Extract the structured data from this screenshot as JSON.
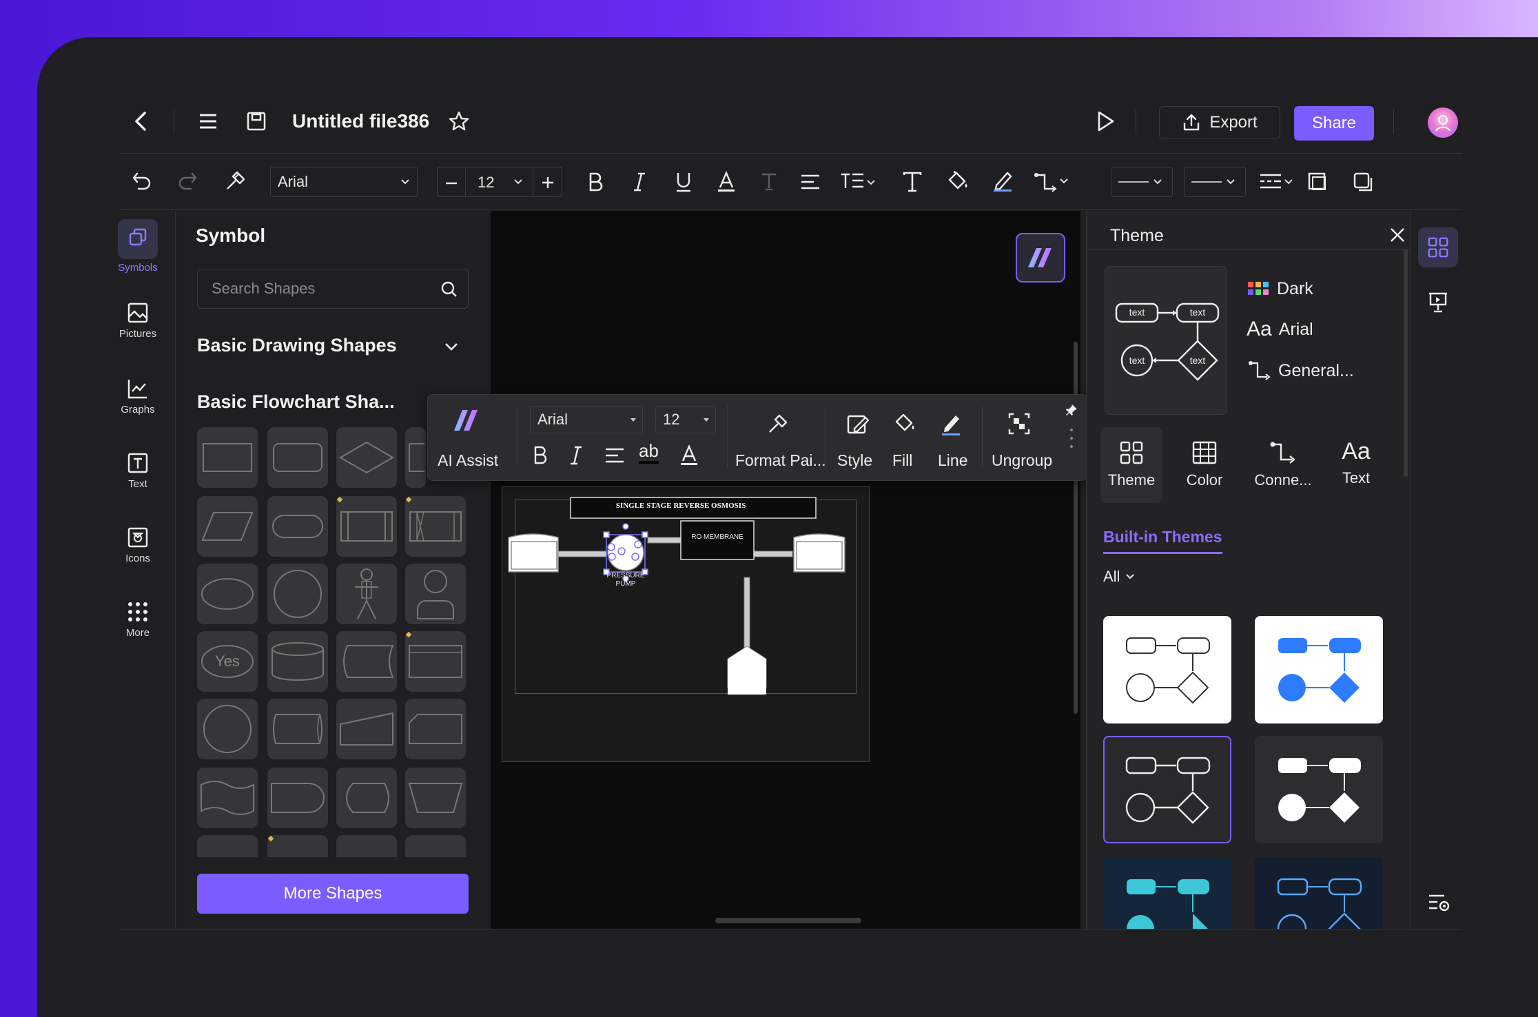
{
  "header": {
    "file_title": "Untitled file386",
    "export_label": "Export",
    "share_label": "Share"
  },
  "toolbar": {
    "font": "Arial",
    "font_size": "12"
  },
  "leftnav": {
    "items": [
      {
        "label": "Symbols",
        "icon": "symbols-icon"
      },
      {
        "label": "Pictures",
        "icon": "pictures-icon"
      },
      {
        "label": "Graphs",
        "icon": "graphs-icon"
      },
      {
        "label": "Text",
        "icon": "text-icon"
      },
      {
        "label": "Icons",
        "icon": "icons-icon"
      },
      {
        "label": "More",
        "icon": "more-grid-icon"
      }
    ]
  },
  "symbol_panel": {
    "title": "Symbol",
    "search_placeholder": "Search Shapes",
    "sections": [
      "Basic Drawing Shapes",
      "Basic Flowchart Sha..."
    ],
    "flow_shape_text": "Yes",
    "more_shapes_label": "More Shapes"
  },
  "floating_toolbar": {
    "ai_assist": "AI Assist",
    "font": "Arial",
    "font_size": "12",
    "ab": "ab",
    "format_painter": "Format Pai...",
    "style": "Style",
    "fill": "Fill",
    "line": "Line",
    "ungroup": "Ungroup"
  },
  "diagram": {
    "title": "SINGLE STAGE REVERSE OSMOSIS",
    "pump_label_1": "PRESSURE",
    "pump_label_2": "PUMP",
    "membrane_label": "RO MEMBRANE"
  },
  "theme_panel": {
    "title": "Theme",
    "preview_labels": [
      "text",
      "text",
      "text",
      "text"
    ],
    "props": [
      {
        "label": "Dark",
        "icon": "palette-icon"
      },
      {
        "label": "Arial",
        "icon": "font-icon",
        "glyph": "Aa"
      },
      {
        "label": "General...",
        "icon": "connector-icon"
      }
    ],
    "tabs": [
      {
        "label": "Theme",
        "glyph": ""
      },
      {
        "label": "Color",
        "glyph": ""
      },
      {
        "label": "Conne...",
        "glyph": ""
      },
      {
        "label": "Text",
        "glyph": "Aa"
      }
    ],
    "built_in_label": "Built-in Themes",
    "filter_label": "All"
  },
  "colors": {
    "accent": "#7b5cff",
    "background": "#1f1f21",
    "canvas": "#0c0c0c",
    "selection": "#7b73ff"
  }
}
